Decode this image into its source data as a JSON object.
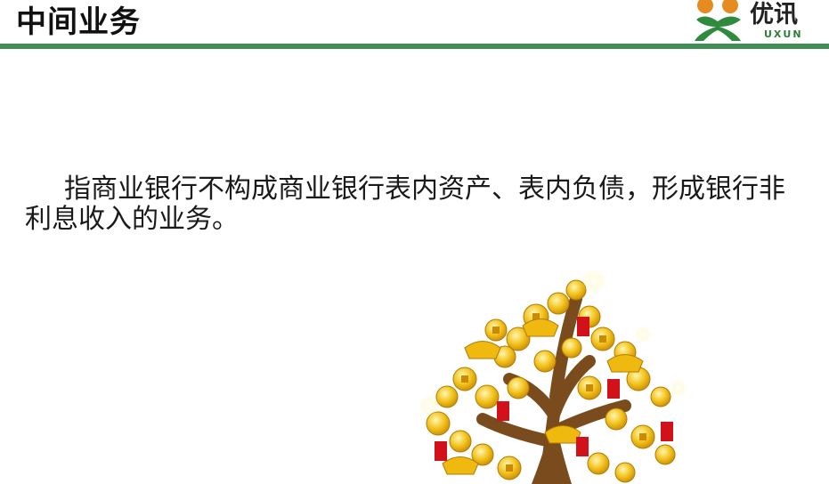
{
  "header": {
    "title": "中间业务",
    "logo": {
      "name_cn": "优讯",
      "name_en": "UXUN",
      "brand_green": "#3f8f52",
      "brand_orange": "#e58b1f"
    }
  },
  "content": {
    "paragraph": "指商业银行不构成商业银行表内资产、表内负债，形成银行非利息收入的业务。"
  },
  "illustration": {
    "subject": "money-tree-icon",
    "colors": {
      "gold": "#f2c21b",
      "trunk": "#7a4b1c",
      "red_envelope": "#d2121b"
    }
  }
}
